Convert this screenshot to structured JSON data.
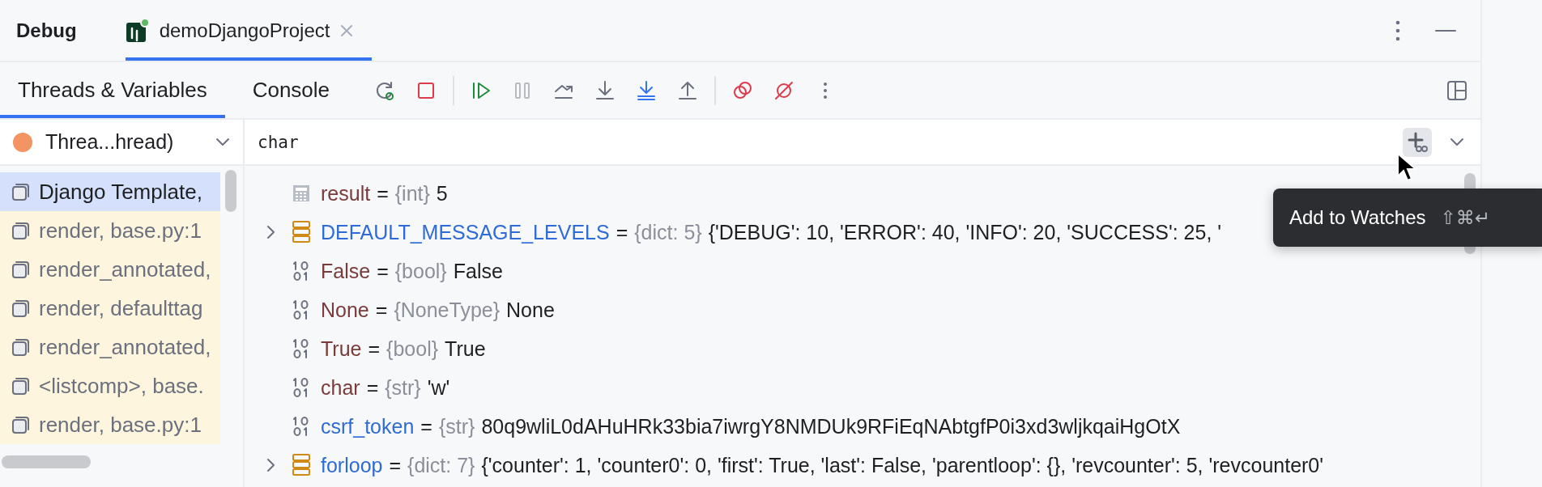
{
  "tool_window": {
    "title": "Debug",
    "tabs": [
      {
        "label": "demoDjangoProject",
        "selected": true,
        "running": true
      }
    ]
  },
  "toolbar": {
    "tabs": [
      {
        "label": "Threads & Variables",
        "selected": true
      },
      {
        "label": "Console",
        "selected": false
      }
    ],
    "actions": [
      {
        "kind": "rerun"
      },
      {
        "kind": "stop"
      },
      {
        "kind": "separator"
      },
      {
        "kind": "resume"
      },
      {
        "kind": "pause",
        "disabled": true
      },
      {
        "kind": "step-over"
      },
      {
        "kind": "step-into"
      },
      {
        "kind": "step-into-my-code"
      },
      {
        "kind": "step-out"
      },
      {
        "kind": "separator"
      },
      {
        "kind": "breakpoints"
      },
      {
        "kind": "mute"
      },
      {
        "kind": "more"
      }
    ]
  },
  "thread_selector": {
    "value": "Threa...hread)"
  },
  "frames": [
    {
      "label": "Django Template,",
      "selected": true
    },
    {
      "label": "render, base.py:1",
      "selected": false
    },
    {
      "label": "render_annotated,",
      "selected": false
    },
    {
      "label": "render, defaulttag",
      "selected": false
    },
    {
      "label": "render_annotated,",
      "selected": false
    },
    {
      "label": "<listcomp>, base.",
      "selected": false
    },
    {
      "label": "render, base.py:1",
      "selected": false
    }
  ],
  "expression_field": {
    "value": "char"
  },
  "variables": [
    {
      "name": "result",
      "operator": "=",
      "type": "{int}",
      "value": "5",
      "kind": "number",
      "expandable": false,
      "color": "#7a3b3b"
    },
    {
      "name": "DEFAULT_MESSAGE_LEVELS",
      "operator": "=",
      "type": "{dict: 5}",
      "value": "{'DEBUG': 10, 'ERROR': 40, 'INFO': 20, 'SUCCESS': 25, '",
      "kind": "dict",
      "expandable": true,
      "color": "#2f6bd6"
    },
    {
      "name": "False",
      "operator": "=",
      "type": "{bool}",
      "value": "False",
      "kind": "primitive",
      "expandable": false,
      "color": "#7a3b3b"
    },
    {
      "name": "None",
      "operator": "=",
      "type": "{NoneType}",
      "value": "None",
      "kind": "primitive",
      "expandable": false,
      "color": "#7a3b3b"
    },
    {
      "name": "True",
      "operator": "=",
      "type": "{bool}",
      "value": "True",
      "kind": "primitive",
      "expandable": false,
      "color": "#7a3b3b"
    },
    {
      "name": "char",
      "operator": "=",
      "type": "{str}",
      "value": "'w'",
      "kind": "primitive",
      "expandable": false,
      "color": "#7a3b3b"
    },
    {
      "name": "csrf_token",
      "operator": "=",
      "type": "{str}",
      "value": "80q9wliL0dAHuHRk33bia7iwrgY8NMDUk9RFiEqNAbtgfP0i3xd3wljkqaiHgOtX",
      "kind": "primitive",
      "expandable": false,
      "color": "#2f6bd6"
    },
    {
      "name": "forloop",
      "operator": "=",
      "type": "{dict: 7}",
      "value": "{'counter': 1, 'counter0': 0, 'first': True, 'last': False, 'parentloop': {}, 'revcounter': 5, 'revcounter0'",
      "kind": "dict",
      "expandable": true,
      "color": "#2f6bd6"
    }
  ],
  "tooltip": {
    "text": "Add to Watches",
    "shortcut": "⇧⌘↵"
  }
}
